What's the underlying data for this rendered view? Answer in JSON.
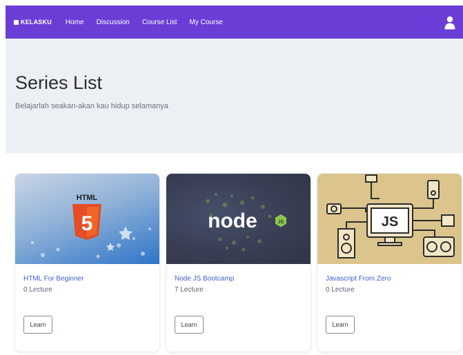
{
  "navbar": {
    "brand": "KELASKU",
    "links": [
      "Home",
      "Discussion",
      "Course List",
      "My Course"
    ],
    "user_icon": "user-icon",
    "color": "#6a3ed6"
  },
  "hero": {
    "title": "Series List",
    "subtitle": "Belajarlah seakan-akan kau hidup selamanya"
  },
  "courses": [
    {
      "title": "HTML For Beginner",
      "lectures": "0 Lecture",
      "image_badge": "HTML",
      "image_number": "5",
      "button": "Learn"
    },
    {
      "title": "Node JS Bootcamp",
      "lectures": "7 Lecture",
      "image_text": "node",
      "button": "Learn"
    },
    {
      "title": "Javascript From Zero",
      "lectures": "0 Lecture",
      "image_text": "JS",
      "button": "Learn"
    }
  ]
}
